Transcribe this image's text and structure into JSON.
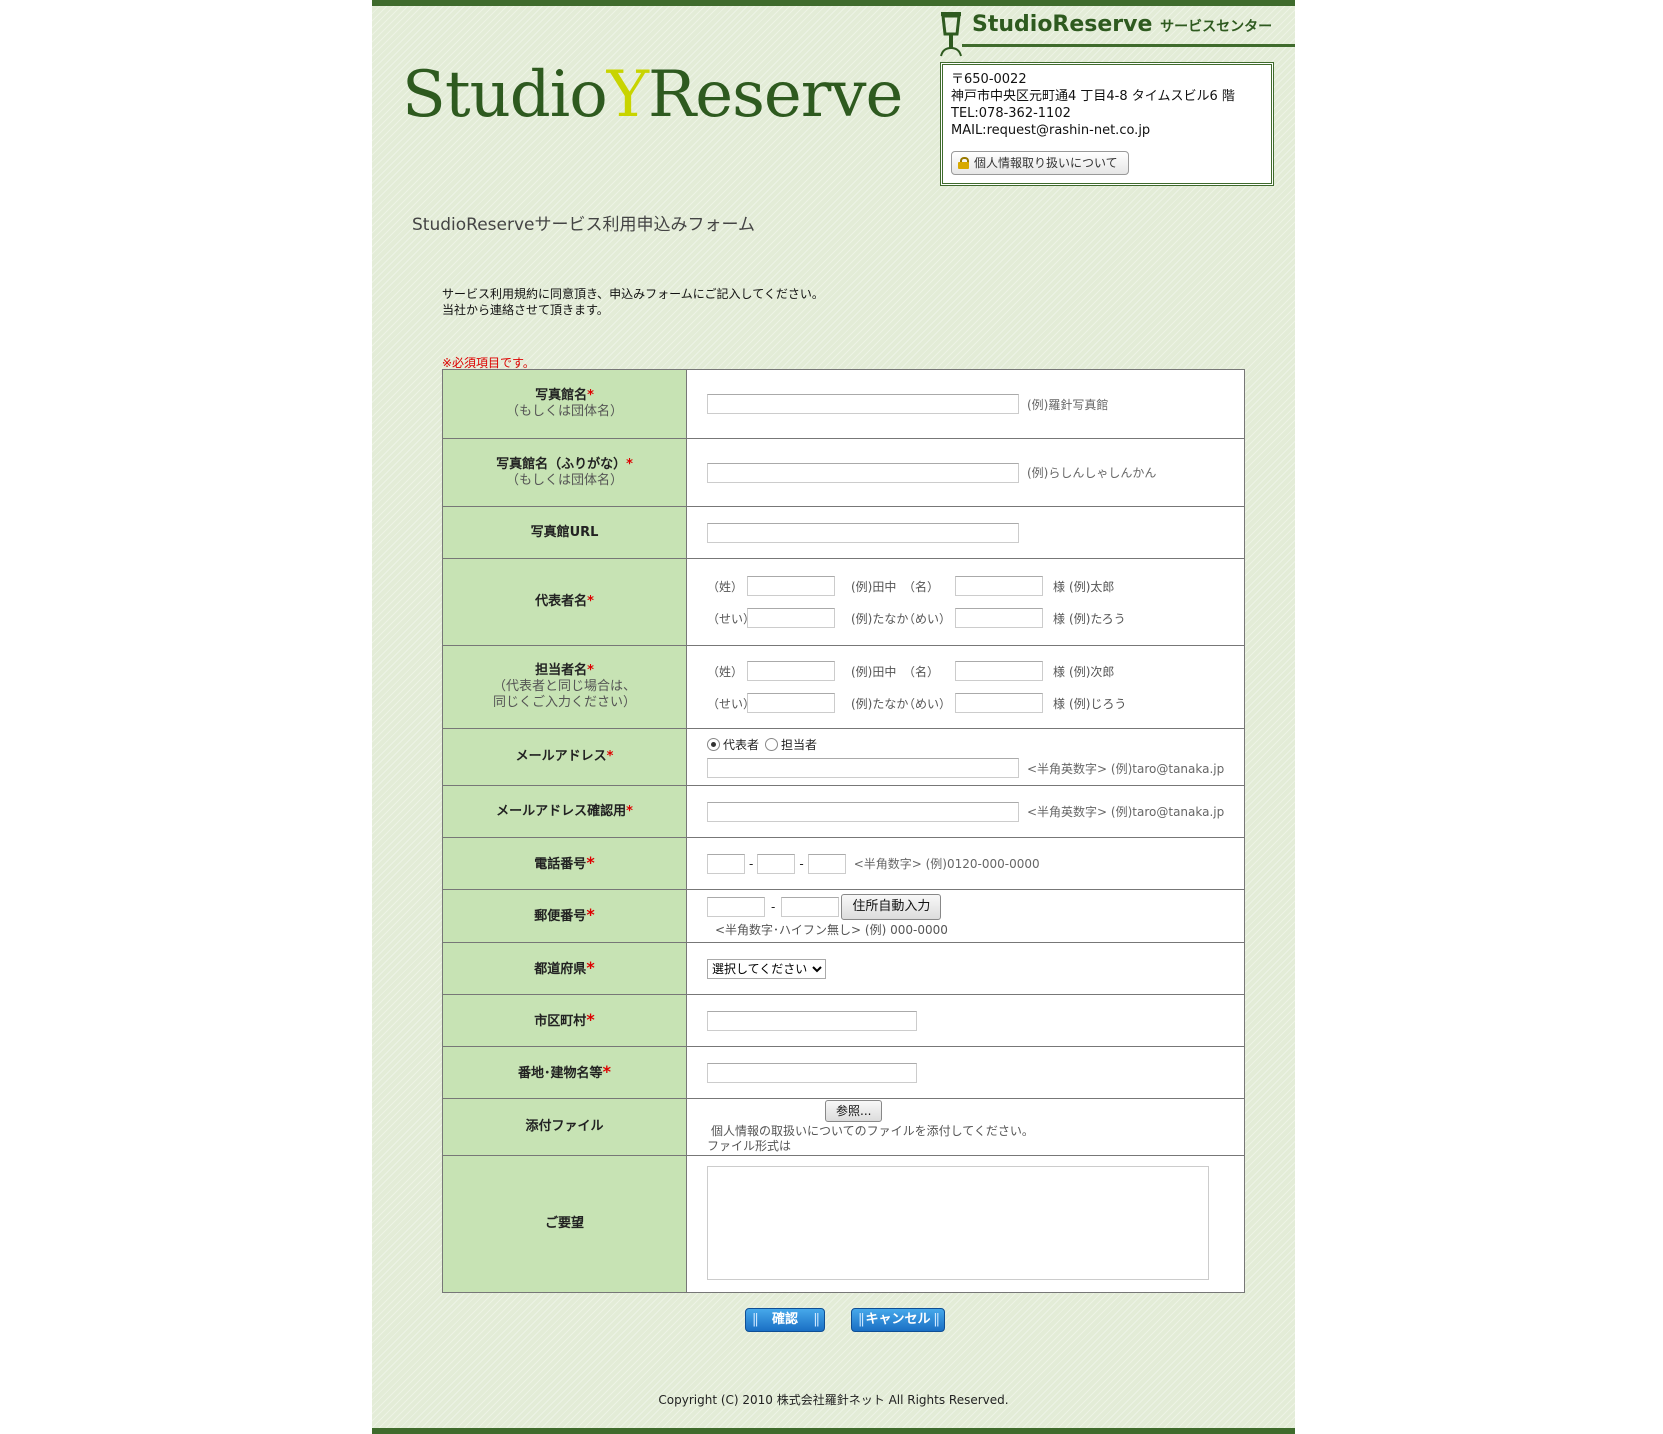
{
  "header": {
    "logo_text_left": "Studio",
    "logo_text_right": "Reserve",
    "service_name": "StudioReserve",
    "service_suffix": "サービスセンター",
    "contact": {
      "postal": "〒650-0022",
      "address": "神戸市中央区元町通4 丁目4-8  タイムスビル6 階",
      "tel": "TEL:078-362-1102",
      "mail": "MAIL:request@rashin-net.co.jp"
    },
    "privacy_button": "個人情報取り扱いについて"
  },
  "page_title": "StudioReserveサービス利用申込みフォーム",
  "intro": {
    "line1": "サービス利用規約に同意頂き、申込みフォームにご記入してください。",
    "line2": "当社から連絡させて頂きます。"
  },
  "required_note": "※必須項目です。",
  "fields": {
    "studio_name": {
      "label": "写真館名",
      "sub": "（もしくは団体名）",
      "example": "(例)羅針写真館"
    },
    "studio_kana": {
      "label": "写真館名（ふりがな）",
      "sub": "（もしくは団体名）",
      "example": "(例)らしんしゃしんかん"
    },
    "studio_url": {
      "label": "写真館URL"
    },
    "rep": {
      "label": "代表者名",
      "sei": "（姓）",
      "sei_ex": "(例)田中",
      "mei": "（名）",
      "sama": "様",
      "mei_ex": "(例)太郎",
      "sei_kana": "（せい）",
      "sei_kana_ex": "(例)たなか",
      "mei_kana": "（めい）",
      "mei_kana_ex": "(例)たろう"
    },
    "contact": {
      "label": "担当者名",
      "sub1": "（代表者と同じ場合は、",
      "sub2": "同じくご入力ください）",
      "sei": "（姓）",
      "sei_ex": "(例)田中",
      "mei": "（名）",
      "sama": "様",
      "mei_ex": "(例)次郎",
      "sei_kana": "（せい）",
      "sei_kana_ex": "(例)たなか",
      "mei_kana": "（めい）",
      "mei_kana_ex": "(例)じろう"
    },
    "email": {
      "label": "メールアドレス",
      "radio1": "代表者",
      "radio2": "担当者",
      "example": "<半角英数字> (例)taro@tanaka.jp"
    },
    "email_confirm": {
      "label": "メールアドレス確認用",
      "example": "<半角英数字> (例)taro@tanaka.jp"
    },
    "phone": {
      "label": "電話番号",
      "dash": "-",
      "example": "<半角数字> (例)0120-000-0000"
    },
    "postal": {
      "label": "郵便番号",
      "dash": "-",
      "button": "住所自動入力",
      "example": "<半角数字･ハイフン無し> (例) 000-0000"
    },
    "prefecture": {
      "label": "都道府県",
      "selected": "選択してください"
    },
    "city": {
      "label": "市区町村"
    },
    "street": {
      "label": "番地･建物名等"
    },
    "attachment": {
      "label": "添付ファイル",
      "button": "参照...",
      "note1": "個人情報の取扱いについてのファイルを添付してください。",
      "note2": "ファイル形式は"
    },
    "request": {
      "label": "ご要望"
    }
  },
  "asterisk": "*",
  "buttons": {
    "confirm": "確認",
    "cancel": "キャンセル"
  },
  "copyright": "Copyright (C) 2010   株式会社羅針ネット   All Rights Reserved."
}
